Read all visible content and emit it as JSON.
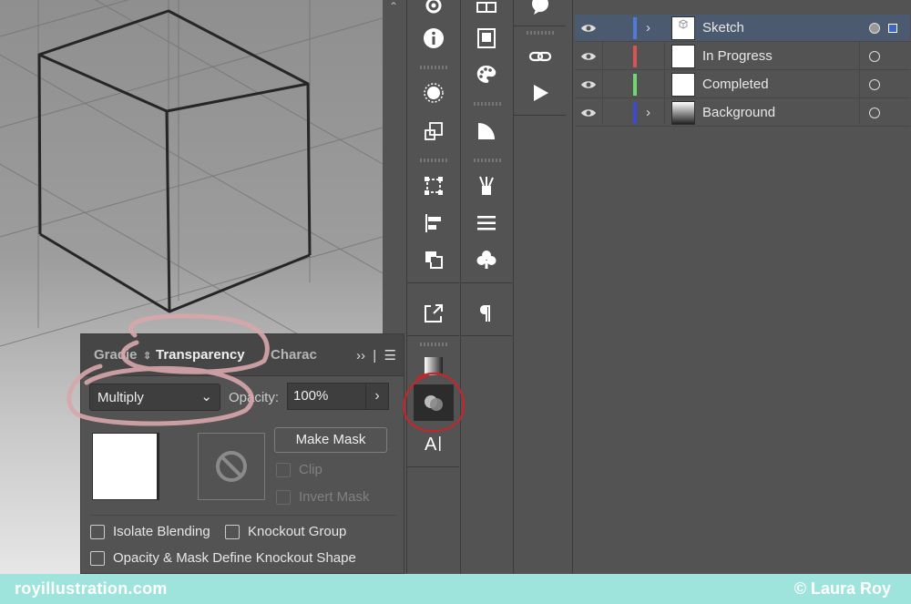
{
  "layers": {
    "rows": [
      {
        "name": "Sketch",
        "color": "#4f7cd9",
        "expandable": true,
        "selected": true,
        "thumb": "sketch"
      },
      {
        "name": "In Progress",
        "color": "#d9534f",
        "expandable": false,
        "selected": false,
        "thumb": "white"
      },
      {
        "name": "Completed",
        "color": "#6fd96f",
        "expandable": false,
        "selected": false,
        "thumb": "white"
      },
      {
        "name": "Background",
        "color": "#3b4bd1",
        "expandable": true,
        "selected": false,
        "thumb": "gradient"
      }
    ]
  },
  "transparency_panel": {
    "tab_left": "Gradie",
    "tab_active": "Transparency",
    "tab_right": "Charac",
    "blend_mode": "Multiply",
    "opacity_label": "Opacity:",
    "opacity_value": "100%",
    "make_mask_label": "Make Mask",
    "clip_label": "Clip",
    "invert_mask_label": "Invert Mask",
    "isolate_blending_label": "Isolate Blending",
    "knockout_group_label": "Knockout Group",
    "opacity_mask_label": "Opacity & Mask Define Knockout Shape"
  },
  "footer": {
    "site": "royillustration.com",
    "credit": "© Laura Roy"
  },
  "colors": {
    "annotation_red": "#c4262b",
    "footer_bg": "#9ee3dc",
    "selected_row": "#4b5a6e"
  },
  "toolbar_icons": {
    "col1": [
      "helm-icon",
      "info-icon",
      "circle-select-icon",
      "transform-icon",
      "free-transform-icon",
      "align-icon",
      "pathfinder-icon",
      "export-icon",
      "gradient-icon",
      "transparency-icon",
      "type-icon"
    ],
    "col2": [
      "artboards-icon",
      "libraries-icon",
      "color-palette-icon",
      "gradient-swatch-icon",
      "brushes-icon",
      "stroke-icon",
      "symbols-icon",
      "paragraph-icon"
    ],
    "col3": [
      "speech-bubble-icon",
      "links-icon",
      "play-icon"
    ]
  }
}
